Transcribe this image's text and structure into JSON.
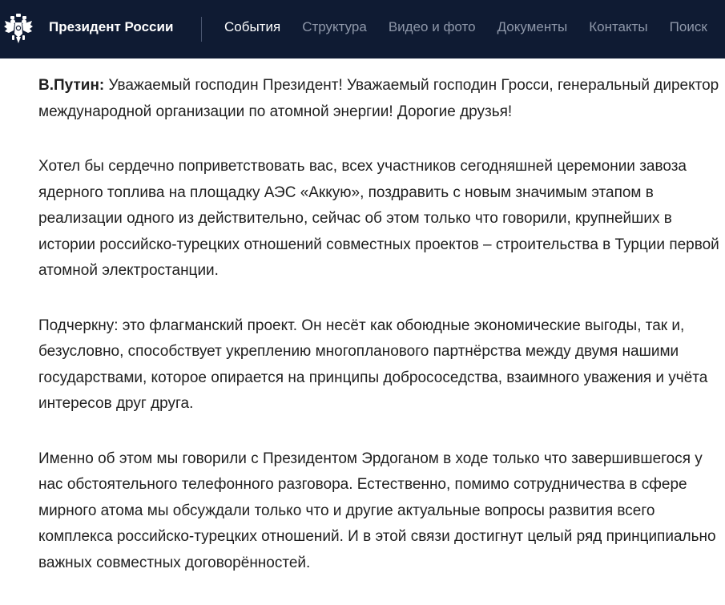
{
  "header": {
    "site_title": "Президент России",
    "emblem_icon": "double-headed-eagle-icon",
    "background": "#0f1b33",
    "nav": [
      {
        "label": "События",
        "active": true
      },
      {
        "label": "Структура",
        "active": false
      },
      {
        "label": "Видео и фото",
        "active": false
      },
      {
        "label": "Документы",
        "active": false
      },
      {
        "label": "Контакты",
        "active": false
      },
      {
        "label": "Поиск",
        "active": false
      }
    ]
  },
  "article": {
    "speaker": "В.Путин:",
    "paragraphs": [
      "Уважаемый господин Президент! Уважаемый господин Гросси, генеральный директор международной организации по атомной энергии! Дорогие друзья!",
      "Хотел бы сердечно поприветствовать вас, всех участников сегодняшней церемонии завоза ядерного топлива на площадку АЭС «Аккую», поздравить с новым значимым этапом в реализации одного из действительно, сейчас об этом только что говорили, крупнейших в истории российско-турецких отношений совместных проектов – строительства в Турции первой атомной электростанции.",
      "Подчеркну: это флагманский проект. Он несёт как обоюдные экономические выгоды, так и, безусловно, способствует укреплению многопланового партнёрства между двумя нашими государствами, которое опирается на принципы добрососедства, взаимного уважения и учёта интересов друг друга.",
      "Именно об этом мы говорили с Президентом Эрдоганом в ходе только что завершившегося у нас обстоятельного телефонного разговора. Естественно, помимо сотрудничества в сфере мирного атома мы обсуждали только что и другие актуальные вопросы развития всего комплекса российско-турецких отношений. И в этой связи достигнут целый ряд принципиально важных совместных договорённостей."
    ]
  }
}
